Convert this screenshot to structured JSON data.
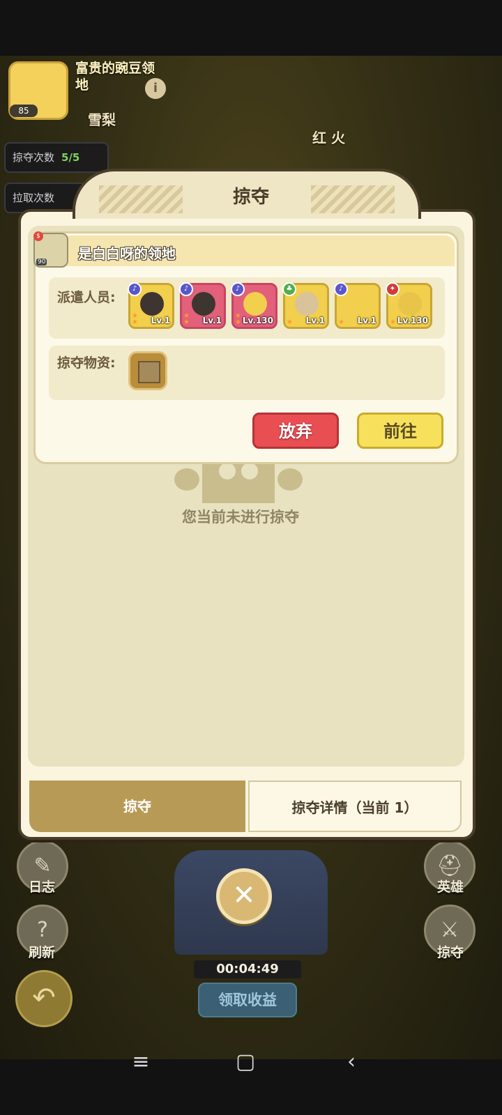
{
  "background": {
    "territory": {
      "name": "富贵的豌豆领地",
      "level": "85"
    },
    "counters": [
      {
        "label": "掠夺次数",
        "value": "5/5"
      },
      {
        "label": "拉取次数",
        "value": ""
      }
    ],
    "labels": {
      "left": "雪梨",
      "right": "红 火"
    },
    "side_buttons": {
      "log": "日志",
      "refresh": "刷新",
      "heroes": "英雄",
      "raid": "掠夺"
    },
    "timer": "00:04:49",
    "claim_button": "领取收益"
  },
  "modal": {
    "title": "掠夺",
    "card": {
      "territory": "是白白呀的领地",
      "avatar_level": "90",
      "dispatch_label": "派遣人员:",
      "heroes": [
        {
          "level": "Lv.1",
          "element": "music"
        },
        {
          "level": "Lv.1",
          "element": "music"
        },
        {
          "level": "Lv.130",
          "element": "music"
        },
        {
          "level": "Lv.1",
          "element": "nature"
        },
        {
          "level": "Lv.1",
          "element": "music"
        },
        {
          "level": "Lv.130",
          "element": "fire"
        }
      ],
      "loot_label": "掠夺物资:",
      "abandon_button": "放弃",
      "go_button": "前往"
    },
    "empty_text": "您当前未进行掠夺",
    "tabs": {
      "raid": "掠夺",
      "detail": "掠夺详情（当前 1）"
    }
  },
  "icons": {
    "close": "close-icon",
    "back": "back-arrow-icon",
    "info": "info-icon"
  }
}
